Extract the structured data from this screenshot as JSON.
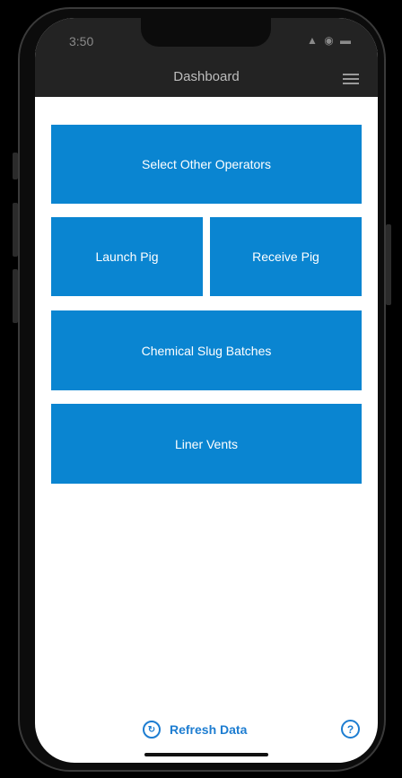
{
  "status_bar": {
    "time": "3:50",
    "icons": "▲ ◉ ▬"
  },
  "header": {
    "title": "Dashboard"
  },
  "tiles": {
    "select_operators": "Select Other Operators",
    "launch_pig": "Launch Pig",
    "receive_pig": "Receive Pig",
    "chemical_slug": "Chemical Slug Batches",
    "liner_vents": "Liner Vents"
  },
  "footer": {
    "refresh_label": "Refresh Data",
    "help_icon": "?"
  },
  "colors": {
    "accent": "#0a85d1",
    "link": "#1d7dd1",
    "header_bg": "#232323"
  }
}
